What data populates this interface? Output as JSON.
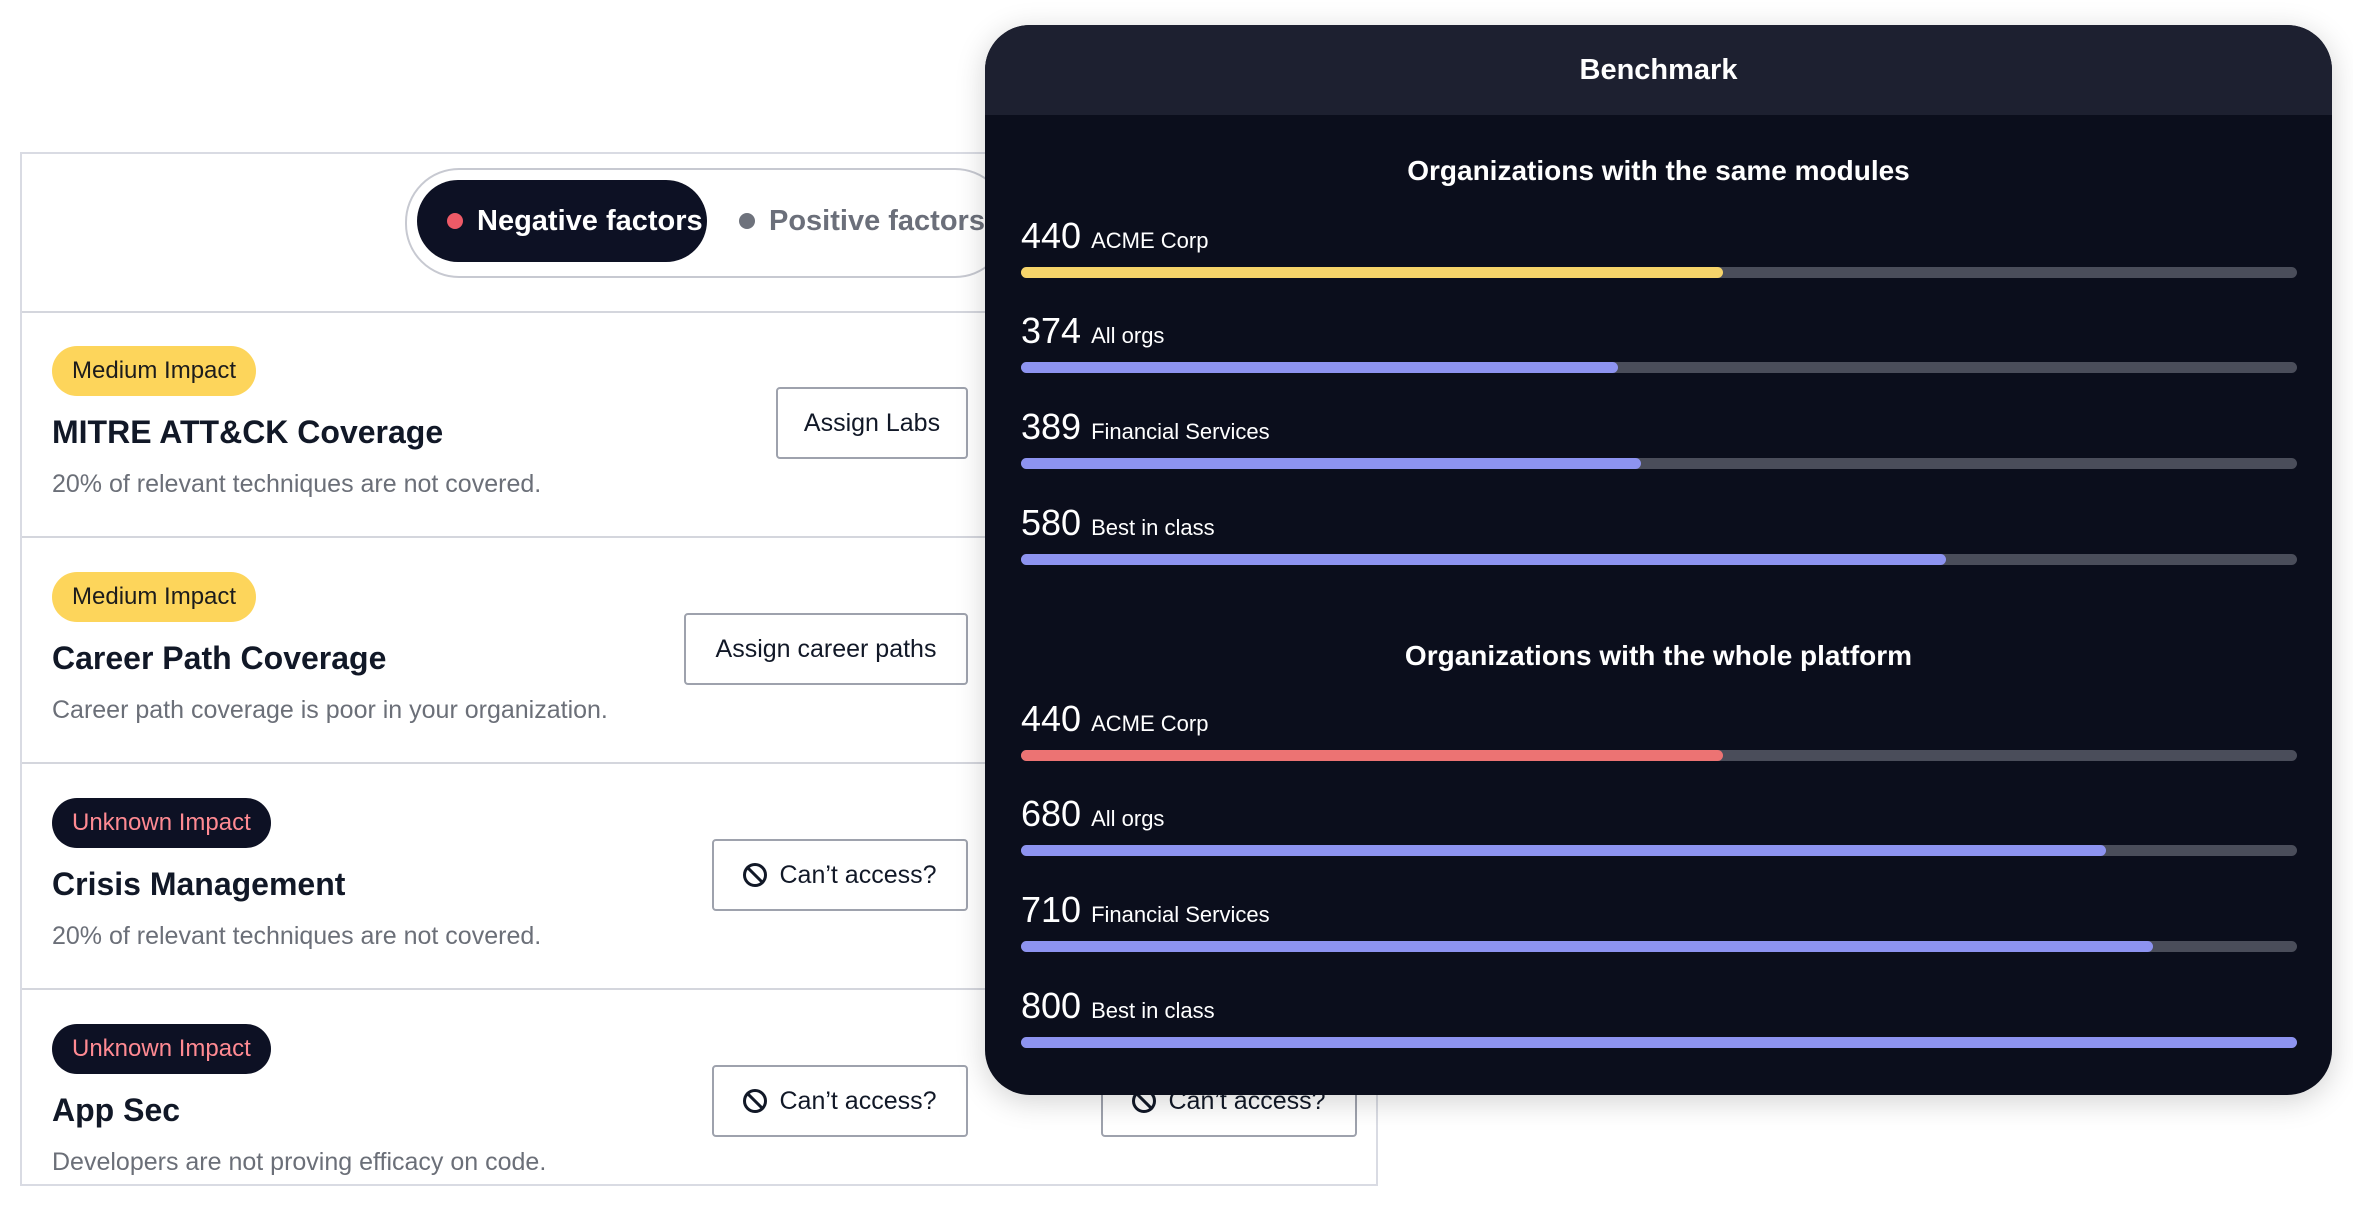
{
  "toggle": {
    "negative_label": "Negative factors",
    "positive_label": "Positive factors"
  },
  "factors": [
    {
      "impact": "Medium Impact",
      "title": "MITRE ATT&CK Coverage",
      "description": "20% of relevant techniques are not covered.",
      "action": "Assign Labs"
    },
    {
      "impact": "Medium Impact",
      "title": "Career Path Coverage",
      "description": "Career path coverage is poor in your organization.",
      "action": "Assign career paths"
    },
    {
      "impact": "Unknown Impact",
      "title": "Crisis Management",
      "description": "20% of relevant techniques are not covered.",
      "action": "Can’t access?"
    },
    {
      "impact": "Unknown Impact",
      "title": "App Sec",
      "description": "Developers are not proving efficacy on code.",
      "action": "Can’t access?"
    }
  ],
  "hidden_action": "Can’t access?",
  "benchmark": {
    "title": "Benchmark",
    "scale_max": 800,
    "sections": [
      {
        "title": "Organizations with the same modules",
        "rows": [
          {
            "value": "440",
            "name": "ACME Corp",
            "score": 440,
            "color": "#f6d46a"
          },
          {
            "value": "374",
            "name": "All orgs",
            "score": 374,
            "color": "#8d93f0"
          },
          {
            "value": "389",
            "name": "Financial Services",
            "score": 389,
            "color": "#8d93f0"
          },
          {
            "value": "580",
            "name": "Best in class",
            "score": 580,
            "color": "#8d93f0"
          }
        ]
      },
      {
        "title": "Organizations with the whole platform",
        "rows": [
          {
            "value": "440",
            "name": "ACME Corp",
            "score": 440,
            "color": "#ec7373"
          },
          {
            "value": "680",
            "name": "All orgs",
            "score": 680,
            "color": "#8d93f0"
          },
          {
            "value": "710",
            "name": "Financial Services",
            "score": 710,
            "color": "#8d93f0"
          },
          {
            "value": "800",
            "name": "Best in class",
            "score": 800,
            "color": "#8d93f0"
          }
        ]
      }
    ]
  }
}
